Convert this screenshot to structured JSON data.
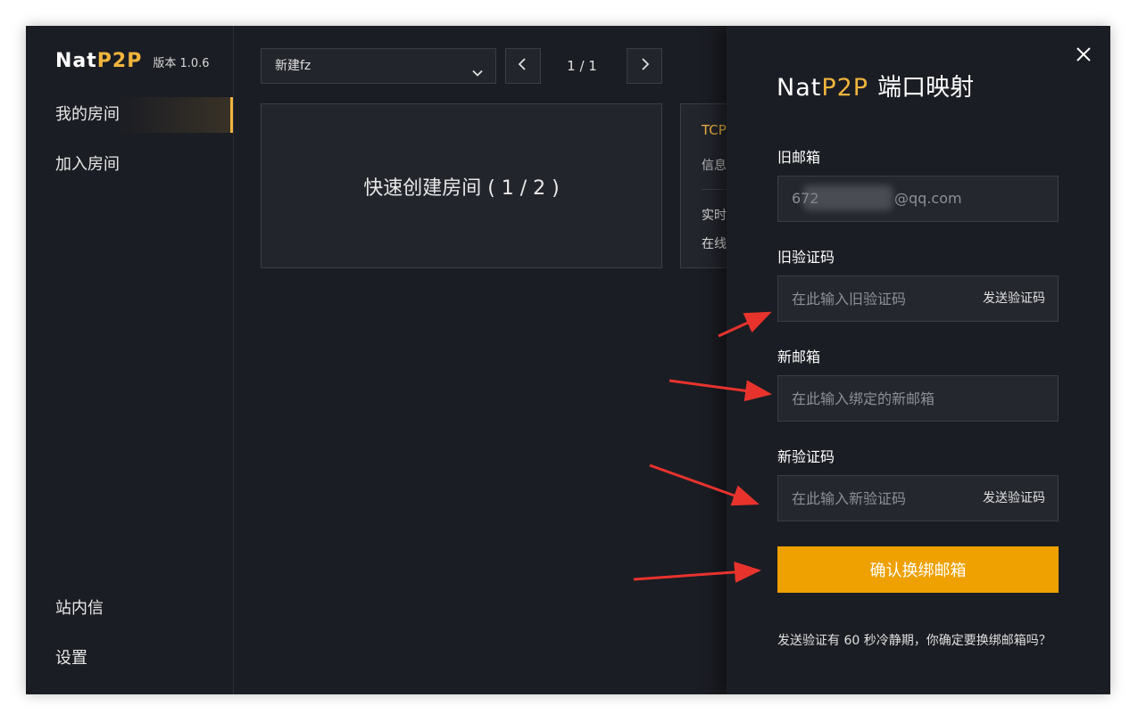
{
  "app": {
    "brand_nat": "Nat",
    "brand_p2p": "P2P",
    "version": "版本 1.0.6"
  },
  "sidebar": {
    "items": [
      {
        "label": "我的房间",
        "active": true
      },
      {
        "label": "加入房间",
        "active": false
      },
      {
        "label": "站内信",
        "active": false
      },
      {
        "label": "设置",
        "active": false
      }
    ]
  },
  "main": {
    "room_select": "新建fz",
    "pager": "1 / 1",
    "quick_create": "快速创建房间 ( 1 / 2 )",
    "info_card": {
      "protocol": "TCP",
      "line1": "信息",
      "line2": "实时",
      "line3": "在线"
    }
  },
  "drawer": {
    "title_nat": "Nat",
    "title_p2p": "P2P",
    "title_rest": "端口映射",
    "old_email_label": "旧邮箱",
    "old_email_value": "@qq.com",
    "old_email_prefix": "672",
    "old_code_label": "旧验证码",
    "old_code_placeholder": "在此输入旧验证码",
    "new_email_label": "新邮箱",
    "new_email_placeholder": "在此输入绑定的新邮箱",
    "new_code_label": "新验证码",
    "new_code_placeholder": "在此输入新验证码",
    "send_code": "发送验证码",
    "confirm": "确认换绑邮箱",
    "hint": "发送验证有 60 秒冷静期，你确定要换绑邮箱吗？"
  },
  "colors": {
    "accent": "#f0b43c",
    "button": "#eea100",
    "background": "#1b1d24",
    "annotation_arrow": "#e8332d"
  },
  "icons": [
    "chevron-down-icon",
    "chevron-left-icon",
    "chevron-right-icon",
    "close-icon",
    "arrow-annotation"
  ]
}
